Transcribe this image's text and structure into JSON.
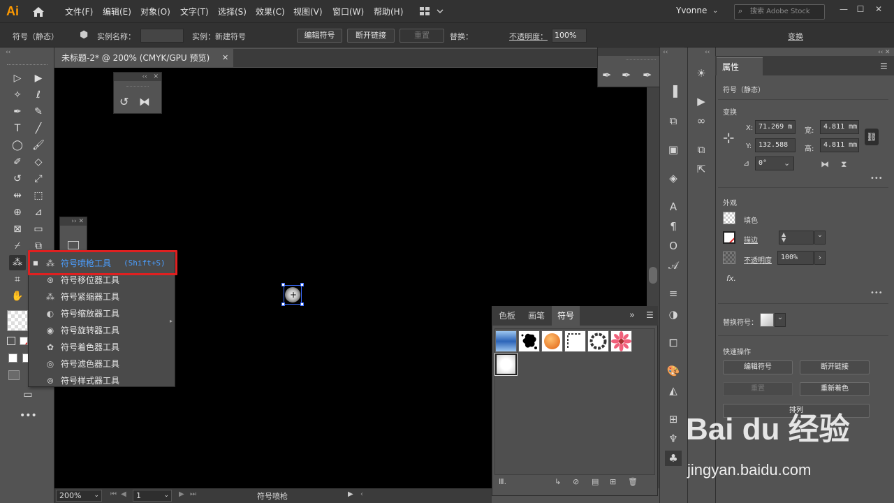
{
  "app": {
    "logo": "Ai",
    "user": "Yvonne",
    "search_placeholder": "搜索 Adobe Stock"
  },
  "menu": [
    "文件(F)",
    "编辑(E)",
    "对象(O)",
    "文字(T)",
    "选择(S)",
    "效果(C)",
    "视图(V)",
    "窗口(W)",
    "帮助(H)"
  ],
  "window_controls": [
    "—",
    "☐",
    "✕"
  ],
  "control_bar": {
    "object_type": "符号（静态）",
    "instance_name_label": "实例名称：",
    "instance_label": "实例：新建符号",
    "edit_symbol": "编辑符号",
    "break_link": "断开链接",
    "reset": "重置",
    "replace_label": "替换：",
    "opacity_label": "不透明度：",
    "opacity_value": "100%",
    "transform": "变换"
  },
  "document": {
    "tab_title": "未标题-2* @ 200% (CMYK/GPU 预览)",
    "close": "✕"
  },
  "tool_flyout": {
    "items": [
      {
        "icon": "symbol-sprayer-icon",
        "label": "符号喷枪工具",
        "shortcut": "(Shift+S)",
        "active": true
      },
      {
        "icon": "symbol-shifter-icon",
        "label": "符号移位器工具",
        "shortcut": ""
      },
      {
        "icon": "symbol-scruncher-icon",
        "label": "符号紧缩器工具",
        "shortcut": ""
      },
      {
        "icon": "symbol-sizer-icon",
        "label": "符号缩放器工具",
        "shortcut": ""
      },
      {
        "icon": "symbol-spinner-icon",
        "label": "符号旋转器工具",
        "shortcut": ""
      },
      {
        "icon": "symbol-stainer-icon",
        "label": "符号着色器工具",
        "shortcut": ""
      },
      {
        "icon": "symbol-screener-icon",
        "label": "符号滤色器工具",
        "shortcut": ""
      },
      {
        "icon": "symbol-styler-icon",
        "label": "符号样式器工具",
        "shortcut": ""
      }
    ]
  },
  "symbols_panel": {
    "tabs": [
      "色板",
      "画笔",
      "符号"
    ],
    "active_tab": "符号",
    "more": "»"
  },
  "properties": {
    "tab": "属性",
    "object_type": "符号（静态）",
    "transform_title": "变换",
    "x_label": "X:",
    "x_value": "71.269 m",
    "y_label": "Y:",
    "y_value": "132.588",
    "w_label": "宽:",
    "w_value": "4.811 mm",
    "h_label": "高:",
    "h_value": "4.811 mm",
    "angle_value": "0°",
    "appearance_title": "外观",
    "fill_label": "填色",
    "stroke_label": "描边",
    "opacity_label": "不透明度",
    "opacity_value": "100%",
    "fx_label": "fx.",
    "replace_symbol_label": "替换符号：",
    "quick_actions_title": "快速操作",
    "edit_symbol": "编辑符号",
    "break_link": "断开链接",
    "reset": "重置",
    "recolor": "重新着色",
    "arrange": "排列",
    "more": "•••"
  },
  "status_bar": {
    "zoom": "200%",
    "page": "1",
    "tool_name": "符号喷枪"
  },
  "watermark": {
    "line1": "Bai du 经验",
    "line2": "jingyan.baidu.com"
  },
  "colors": {
    "highlight": "#e02020",
    "selection": "#3a6cff",
    "accent": "#4a9eff"
  }
}
